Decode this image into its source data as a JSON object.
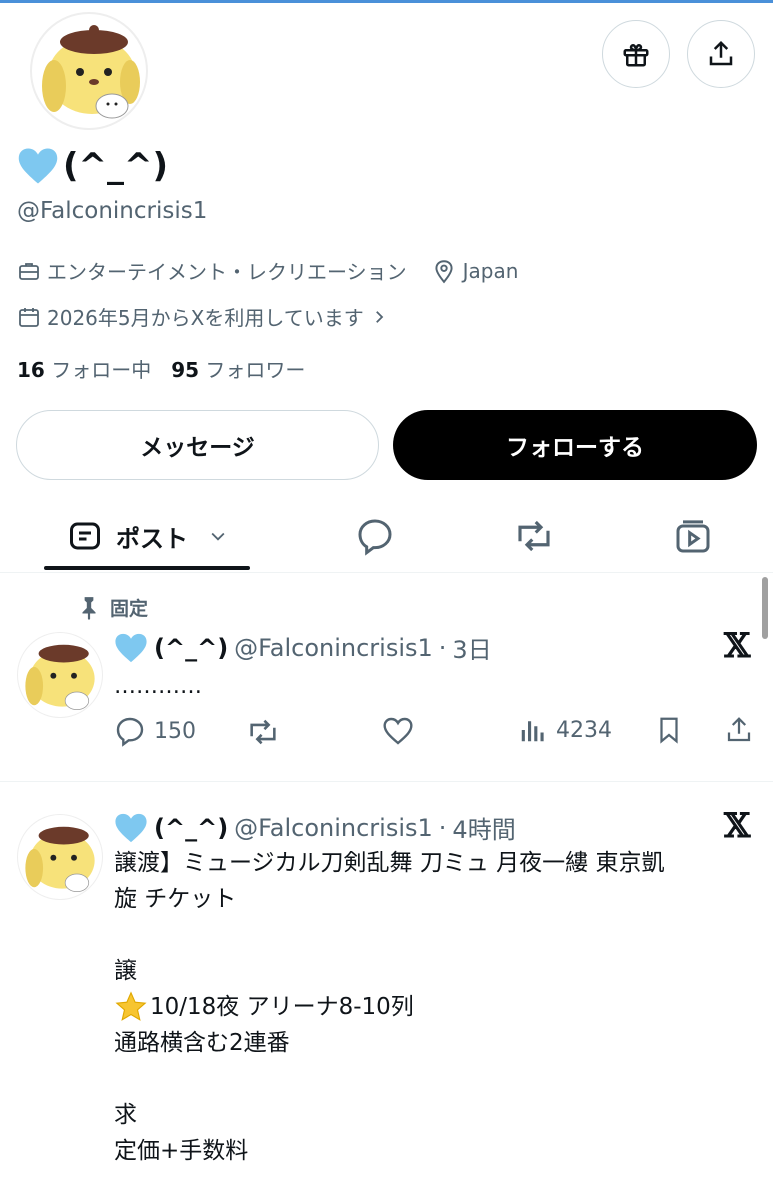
{
  "profile": {
    "display_name": "(^_^)",
    "handle": "@Falconincrisis1",
    "category": "エンターテイメント・レクリエーション",
    "location": "Japan",
    "joined": "2026年5月からXを利用しています",
    "following_count": "16",
    "following_label": "フォロー中",
    "followers_count": "95",
    "followers_label": "フォロワー"
  },
  "buttons": {
    "message": "メッセージ",
    "follow": "フォローする"
  },
  "tabs": {
    "posts_label": "ポスト"
  },
  "posts": [
    {
      "pinned_label": "固定",
      "name": "(^_^)",
      "handle": "@Falconincrisis1",
      "time": "3日",
      "text": "…………",
      "replies": "150",
      "views": "4234"
    },
    {
      "name": "(^_^)",
      "handle": "@Falconincrisis1",
      "time": "4時間",
      "lines": [
        "譲渡】ミュージカル刀剣乱舞 刀ミュ 月夜一縷 東京凱",
        "旋 チケット",
        "",
        "譲",
        "10/18夜 アリーナ8-10列",
        "通路横含む2連番",
        "",
        "求",
        "定価+手数料"
      ]
    }
  ],
  "colors": {
    "accent_blue": "#4a90d9",
    "heart_light_blue": "#7ec8f0",
    "muted_text": "#536471"
  }
}
